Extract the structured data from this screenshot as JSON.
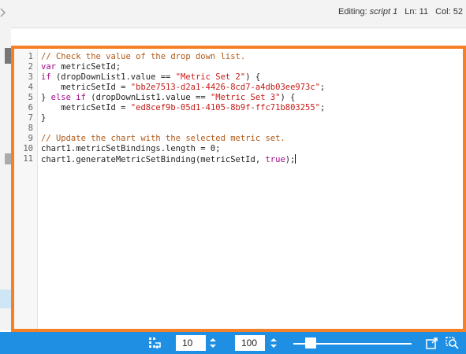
{
  "status": {
    "editing_label": "Editing:",
    "script_name": "script 1",
    "line_label": "Ln:",
    "line_value": "11",
    "col_label": "Col:",
    "col_value": "52"
  },
  "editor": {
    "lines": [
      {
        "n": "1",
        "code": "// Check the value of the drop down list."
      },
      {
        "n": "2",
        "code": "var metricSetId;"
      },
      {
        "n": "3",
        "code": "if (dropDownList1.value == \"Metric Set 2\") {"
      },
      {
        "n": "4",
        "code": "    metricSetId = \"bb2e7513-d2a1-4426-8cd7-a4db03ee973c\";"
      },
      {
        "n": "5",
        "code": "} else if (dropDownList1.value == \"Metric Set 3\") {"
      },
      {
        "n": "6",
        "code": "    metricSetId = \"ed8cef9b-05d1-4105-8b9f-ffc71b803255\";"
      },
      {
        "n": "7",
        "code": "}"
      },
      {
        "n": "8",
        "code": ""
      },
      {
        "n": "9",
        "code": "// Update the chart with the selected metric set."
      },
      {
        "n": "10",
        "code": "chart1.metricSetBindings.length = 0;"
      },
      {
        "n": "11",
        "code": "chart1.generateMetricSetBinding(metricSetId, true);"
      }
    ]
  },
  "toolbar": {
    "page_size": "10",
    "zoom": "100",
    "zoom_slider_fraction": 0.11
  },
  "colors": {
    "accent": "#f58025",
    "toolbar_bg": "#1f8fe3",
    "keyword": "#a00c8a",
    "string": "#c41a16",
    "comment": "#b05a1a"
  },
  "icons": {
    "pager": "page-break-icon",
    "fit": "fit-to-window-icon",
    "zoom_find": "zoom-search-icon"
  }
}
